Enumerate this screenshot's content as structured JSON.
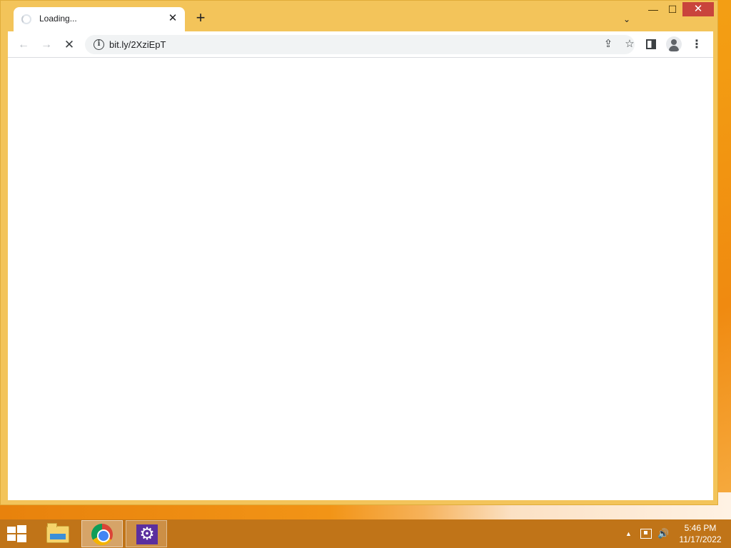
{
  "browser": {
    "tab": {
      "title": "Loading...",
      "close_glyph": "✕"
    },
    "new_tab_glyph": "+",
    "tab_search_glyph": "⌄",
    "window_controls": {
      "minimize": "—",
      "maximize": "☐",
      "close": "✕"
    },
    "toolbar": {
      "back_glyph": "←",
      "forward_glyph": "→",
      "stop_glyph": "✕",
      "info_glyph": "i",
      "url": "bit.ly/2XziEpT",
      "share_glyph": "⇪",
      "bookmark_glyph": "☆",
      "menu_glyph": "⋮"
    }
  },
  "taskbar": {
    "apps": [
      {
        "name": "file-explorer-icon"
      },
      {
        "name": "chrome-icon"
      },
      {
        "name": "settings-icon"
      }
    ],
    "tray": {
      "up_glyph": "▲",
      "volume_glyph": "🔊",
      "time": "5:46 PM",
      "date": "11/17/2022"
    }
  },
  "colors": {
    "window_frame": "#f3c45a",
    "close_button": "#c9443c",
    "taskbar": "#c07418"
  }
}
